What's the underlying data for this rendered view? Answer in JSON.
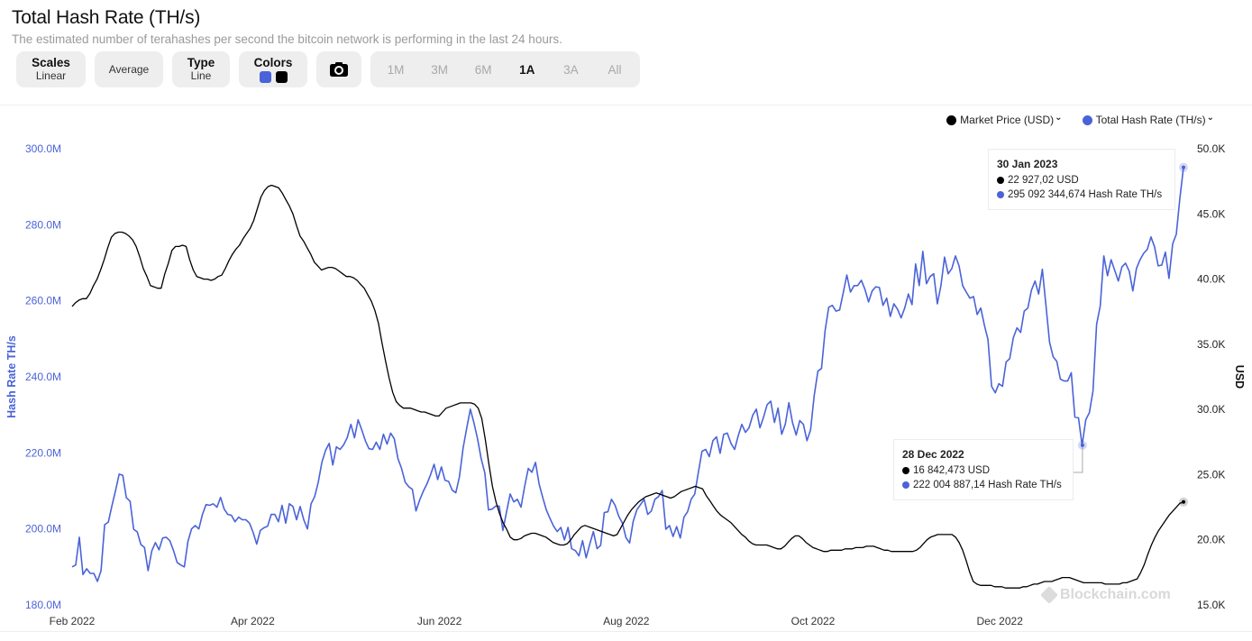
{
  "header": {
    "title": "Total Hash Rate (TH/s)",
    "subtitle": "The estimated number of terahashes per second the bitcoin network is performing in the last 24 hours."
  },
  "toolbar": {
    "scales_label": "Scales",
    "scales_value": "Linear",
    "average_label": "Average",
    "type_label": "Type",
    "type_value": "Line",
    "colors_label": "Colors",
    "colors": [
      "#4a63d8",
      "#000000"
    ],
    "camera_icon": "camera-icon",
    "ranges": [
      "1M",
      "3M",
      "6M",
      "1A",
      "3A",
      "All"
    ],
    "active_range": "1A"
  },
  "legend": {
    "items": [
      {
        "label": "Market Price (USD)",
        "color": "#000000",
        "icon": "chevron-down-icon"
      },
      {
        "label": "Total Hash Rate (TH/s)",
        "color": "#4a63d8",
        "icon": "chevron-down-icon"
      }
    ]
  },
  "tooltips": [
    {
      "date": "30 Jan 2023",
      "price": "22 927,02 USD",
      "hash": "295 092 344,674 Hash Rate TH/s"
    },
    {
      "date": "28 Dec 2022",
      "price": "16 842,473 USD",
      "hash": "222 004 887,14 Hash Rate TH/s"
    }
  ],
  "watermark": "Blockchain.com",
  "chart_data": {
    "type": "line",
    "title": "Total Hash Rate (TH/s)",
    "xlabel": "",
    "ylabel_left": "Hash Rate TH/s",
    "ylabel_right": "USD",
    "x_range": [
      "2022-02-01",
      "2023-01-30"
    ],
    "x_ticks": [
      "Feb 2022",
      "Apr 2022",
      "Jun 2022",
      "Aug 2022",
      "Oct 2022",
      "Dec 2022"
    ],
    "x_tick_days": [
      0,
      59,
      120,
      181,
      242,
      303
    ],
    "y_left": {
      "range": [
        180,
        300
      ],
      "unit": "M",
      "ticks": [
        "180.0M",
        "200.0M",
        "220.0M",
        "240.0M",
        "260.0M",
        "280.0M",
        "300.0M"
      ],
      "tick_values": [
        180,
        200,
        220,
        240,
        260,
        280,
        300
      ]
    },
    "y_right": {
      "range": [
        15,
        50
      ],
      "unit": "K",
      "ticks": [
        "15.0K",
        "20.0K",
        "25.0K",
        "30.0K",
        "35.0K",
        "40.0K",
        "45.0K",
        "50.0K"
      ],
      "tick_values": [
        15,
        20,
        25,
        30,
        35,
        40,
        45,
        50
      ]
    },
    "grid": false,
    "legend_position": "top-right",
    "series": [
      {
        "name": "Total Hash Rate (TH/s)",
        "axis": "left",
        "unit": "million TH/s",
        "color": "#4a63d8",
        "day_step": 1.183,
        "values": [
          190.0,
          190.5,
          197.8,
          188.0,
          189.5,
          188.3,
          188.3,
          186.2,
          189.0,
          201.1,
          201.8,
          206.1,
          210.1,
          214.4,
          214.1,
          208.2,
          207.3,
          199.9,
          199.2,
          195.9,
          195.1,
          189.0,
          194.2,
          196.4,
          194.5,
          197.6,
          197.8,
          196.9,
          194.3,
          191.2,
          190.5,
          190.0,
          196.7,
          200.0,
          200.9,
          200.0,
          203.8,
          206.4,
          206.2,
          206.6,
          205.7,
          208.3,
          205.2,
          203.8,
          203.6,
          201.9,
          203.1,
          202.4,
          202.4,
          201.5,
          199.1,
          196.0,
          199.6,
          200.3,
          200.7,
          203.8,
          203.8,
          201.9,
          206.2,
          201.5,
          206.6,
          205.9,
          202.4,
          205.9,
          202.4,
          200.0,
          206.6,
          208.5,
          212.3,
          217.5,
          220.6,
          222.5,
          216.8,
          221.6,
          220.9,
          222.1,
          224.0,
          227.5,
          224.0,
          228.7,
          226.1,
          223.2,
          221.1,
          220.9,
          222.8,
          220.9,
          224.9,
          222.3,
          225.2,
          223.7,
          218.5,
          215.9,
          212.3,
          211.1,
          210.4,
          204.7,
          207.6,
          209.9,
          211.8,
          214.2,
          217.0,
          213.0,
          216.3,
          212.8,
          212.5,
          210.2,
          209.5,
          213.7,
          221.3,
          226.5,
          231.5,
          227.9,
          223.7,
          218.5,
          214.7,
          205.0,
          205.2,
          206.0,
          206.0,
          199.6,
          204.5,
          209.2,
          207.1,
          207.8,
          205.7,
          211.1,
          215.9,
          214.9,
          217.5,
          211.8,
          208.3,
          205.0,
          202.8,
          200.7,
          199.3,
          200.4,
          197.1,
          200.4,
          194.8,
          194.3,
          192.9,
          196.9,
          192.4,
          196.0,
          199.3,
          194.8,
          195.7,
          204.3,
          204.5,
          207.8,
          206.2,
          203.3,
          201.5,
          197.7,
          196.3,
          202.0,
          205.0,
          206.4,
          207.8,
          203.8,
          204.7,
          207.8,
          208.5,
          210.1,
          199.9,
          200.9,
          198.0,
          200.6,
          197.6,
          203.1,
          204.5,
          207.8,
          209.2,
          214.9,
          220.4,
          220.9,
          219.0,
          223.2,
          224.2,
          219.9,
          224.9,
          225.2,
          222.5,
          220.9,
          224.5,
          227.5,
          225.4,
          226.6,
          229.9,
          231.5,
          226.6,
          229.4,
          232.7,
          233.6,
          228.0,
          231.8,
          224.9,
          227.5,
          233.2,
          228.0,
          224.7,
          228.5,
          227.5,
          223.2,
          226.1,
          235.1,
          241.5,
          242.2,
          252.2,
          258.3,
          258.8,
          257.3,
          257.6,
          262.1,
          266.8,
          262.3,
          264.0,
          264.0,
          265.4,
          263.0,
          259.7,
          262.6,
          263.7,
          263.5,
          258.8,
          260.7,
          255.9,
          259.2,
          257.8,
          255.5,
          258.1,
          261.8,
          259.0,
          269.7,
          264.0,
          273.0,
          264.5,
          266.4,
          267.1,
          259.2,
          264.0,
          271.5,
          267.1,
          268.5,
          271.8,
          269.2,
          264.0,
          262.3,
          260.7,
          261.1,
          256.4,
          258.1,
          253.6,
          249.8,
          237.5,
          235.8,
          238.2,
          237.5,
          243.9,
          244.8,
          250.3,
          252.9,
          251.7,
          257.3,
          258.1,
          262.8,
          265.2,
          261.8,
          268.3,
          258.8,
          249.1,
          245.3,
          244.1,
          239.4,
          238.9,
          238.9,
          241.1,
          229.4,
          229.2,
          222.0,
          228.7,
          230.6,
          236.3,
          253.8,
          258.6,
          271.8,
          266.6,
          270.8,
          268.0,
          265.2,
          268.9,
          269.9,
          267.8,
          262.6,
          268.5,
          270.8,
          272.5,
          273.5,
          276.8,
          274.2,
          269.2,
          269.4,
          272.8,
          265.9,
          275.0,
          277.5,
          287.0,
          295.1
        ]
      },
      {
        "name": "Market Price (USD)",
        "axis": "right",
        "unit": "thousand USD",
        "color": "#000000",
        "day_step": 1.183,
        "values": [
          37.9,
          38.2,
          38.4,
          38.5,
          38.5,
          38.9,
          39.5,
          40.0,
          40.7,
          41.5,
          42.4,
          43.2,
          43.5,
          43.6,
          43.6,
          43.5,
          43.3,
          43.0,
          42.5,
          41.7,
          40.8,
          40.2,
          39.5,
          39.4,
          39.3,
          39.3,
          40.4,
          41.2,
          42.2,
          42.5,
          42.5,
          42.6,
          42.5,
          41.5,
          40.7,
          40.2,
          40.1,
          40.0,
          40.0,
          39.9,
          40.0,
          40.2,
          40.3,
          40.8,
          41.4,
          41.9,
          42.3,
          42.6,
          43.1,
          43.5,
          43.9,
          44.5,
          45.4,
          46.3,
          46.8,
          47.1,
          47.2,
          47.1,
          47.0,
          46.6,
          46.1,
          45.6,
          45.0,
          44.1,
          43.3,
          42.9,
          42.4,
          41.9,
          41.3,
          41.0,
          40.7,
          40.8,
          40.9,
          40.9,
          40.8,
          40.6,
          40.4,
          40.2,
          40.2,
          40.1,
          39.9,
          39.6,
          39.3,
          38.8,
          38.3,
          37.6,
          36.6,
          35.1,
          33.7,
          32.4,
          31.3,
          30.6,
          30.3,
          30.1,
          30.1,
          30.1,
          30.0,
          29.9,
          29.8,
          29.8,
          29.7,
          29.6,
          29.5,
          29.5,
          29.8,
          30.1,
          30.2,
          30.3,
          30.4,
          30.5,
          30.5,
          30.5,
          30.5,
          30.4,
          30.1,
          29.3,
          27.7,
          25.8,
          24.1,
          22.9,
          22.0,
          21.3,
          20.8,
          20.2,
          20.0,
          20.0,
          20.1,
          20.3,
          20.4,
          20.5,
          20.5,
          20.4,
          20.3,
          20.2,
          20.0,
          19.8,
          19.7,
          19.6,
          19.6,
          19.7,
          20.0,
          20.4,
          20.7,
          21.0,
          21.1,
          21.0,
          20.9,
          20.8,
          20.7,
          20.6,
          20.5,
          20.4,
          20.3,
          20.4,
          20.9,
          21.4,
          21.9,
          22.3,
          22.6,
          22.9,
          23.1,
          23.3,
          23.4,
          23.5,
          23.6,
          23.5,
          23.4,
          23.3,
          23.2,
          23.3,
          23.5,
          23.7,
          23.8,
          23.9,
          24.0,
          24.1,
          24.0,
          23.9,
          23.4,
          23.0,
          22.6,
          22.2,
          21.9,
          21.7,
          21.5,
          21.3,
          21.0,
          20.7,
          20.4,
          20.2,
          19.9,
          19.7,
          19.6,
          19.6,
          19.6,
          19.6,
          19.5,
          19.4,
          19.3,
          19.3,
          19.5,
          19.8,
          20.1,
          20.3,
          20.3,
          20.1,
          19.8,
          19.6,
          19.4,
          19.3,
          19.2,
          19.1,
          19.1,
          19.2,
          19.2,
          19.2,
          19.2,
          19.3,
          19.3,
          19.3,
          19.4,
          19.4,
          19.4,
          19.5,
          19.5,
          19.5,
          19.4,
          19.3,
          19.2,
          19.2,
          19.1,
          19.1,
          19.1,
          19.1,
          19.1,
          19.1,
          19.1,
          19.2,
          19.4,
          19.7,
          20.0,
          20.2,
          20.3,
          20.4,
          20.4,
          20.4,
          20.4,
          20.4,
          20.2,
          19.8,
          19.2,
          18.4,
          17.5,
          16.8,
          16.6,
          16.5,
          16.5,
          16.5,
          16.5,
          16.4,
          16.4,
          16.4,
          16.3,
          16.3,
          16.3,
          16.3,
          16.3,
          16.4,
          16.4,
          16.5,
          16.6,
          16.6,
          16.7,
          16.8,
          16.8,
          16.8,
          16.9,
          17.0,
          17.1,
          17.1,
          17.1,
          17.0,
          16.9,
          16.8,
          16.7,
          16.7,
          16.7,
          16.7,
          16.7,
          16.7,
          16.6,
          16.6,
          16.6,
          16.6,
          16.6,
          16.7,
          16.7,
          16.8,
          16.9,
          17.0,
          17.5,
          18.1,
          18.9,
          19.6,
          20.2,
          20.7,
          21.1,
          21.5,
          21.9,
          22.2,
          22.5,
          22.8,
          22.9
        ]
      }
    ],
    "annotations": [
      {
        "date": "28 Dec 2022",
        "price_usd": 16842.473,
        "hash_rate": 222004887.14
      },
      {
        "date": "30 Jan 2023",
        "price_usd": 22927.02,
        "hash_rate": 295092344.674
      }
    ]
  }
}
